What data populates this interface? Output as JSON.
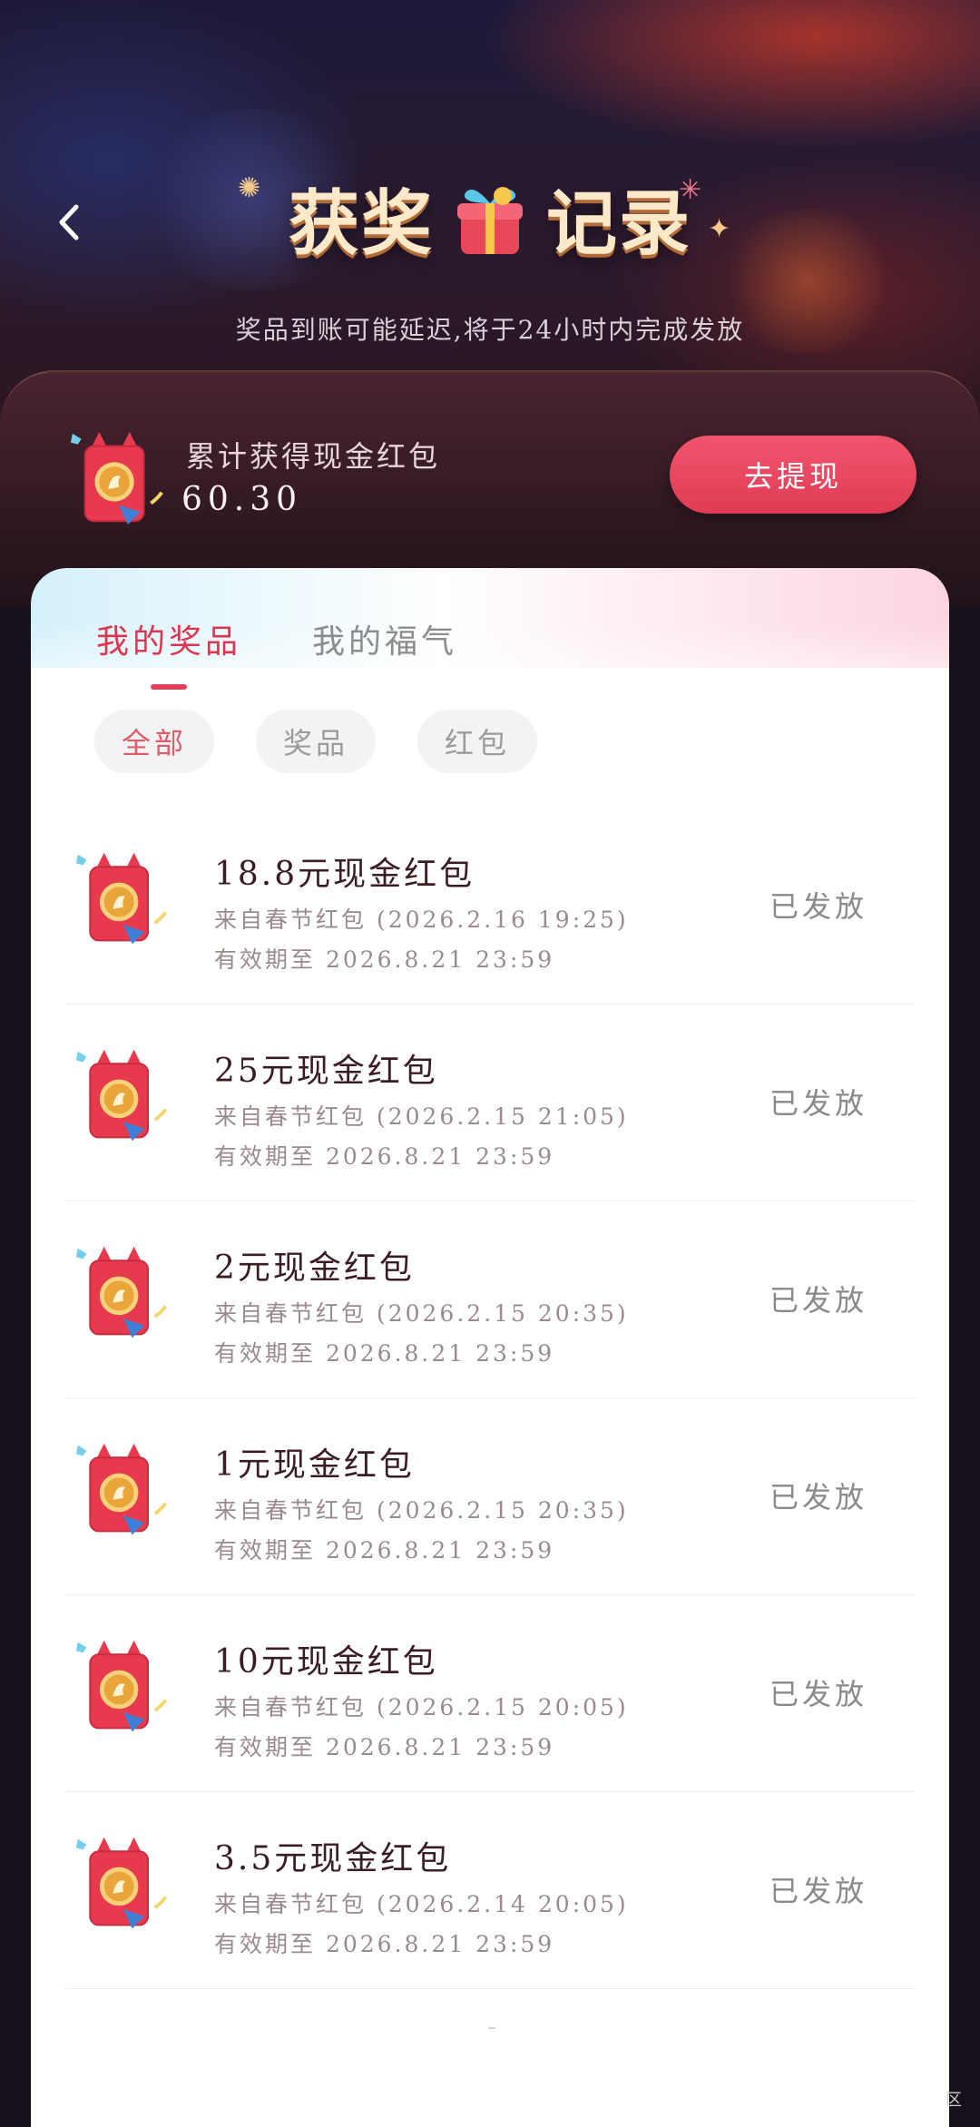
{
  "header": {
    "title_left": "获奖",
    "title_right": "记录",
    "subtitle": "奖品到账可能延迟,将于24小时内完成发放",
    "back_icon": "chevron-left-icon",
    "gift_icon": "gift-box-icon"
  },
  "summary": {
    "label": "累计获得现金红包",
    "amount": "60.30",
    "withdraw_label": "去提现",
    "icon": "red-packet-icon"
  },
  "tabs": [
    {
      "label": "我的奖品",
      "active": true
    },
    {
      "label": "我的福气",
      "active": false
    }
  ],
  "filters": [
    {
      "label": "全部",
      "active": true
    },
    {
      "label": "奖品",
      "active": false
    },
    {
      "label": "红包",
      "active": false
    }
  ],
  "records": [
    {
      "title": "18.8元现金红包",
      "source": "来自春节红包 (2026.2.16 19:25)",
      "expiry": "有效期至 2026.8.21 23:59",
      "status": "已发放"
    },
    {
      "title": "25元现金红包",
      "source": "来自春节红包 (2026.2.15 21:05)",
      "expiry": "有效期至 2026.8.21 23:59",
      "status": "已发放"
    },
    {
      "title": "2元现金红包",
      "source": "来自春节红包 (2026.2.15 20:35)",
      "expiry": "有效期至 2026.8.21 23:59",
      "status": "已发放"
    },
    {
      "title": "1元现金红包",
      "source": "来自春节红包 (2026.2.15 20:35)",
      "expiry": "有效期至 2026.8.21 23:59",
      "status": "已发放"
    },
    {
      "title": "10元现金红包",
      "source": "来自春节红包 (2026.2.15 20:05)",
      "expiry": "有效期至 2026.8.21 23:59",
      "status": "已发放"
    },
    {
      "title": "3.5元现金红包",
      "source": "来自春节红包 (2026.2.14 20:05)",
      "expiry": "有效期至 2026.8.21 23:59",
      "status": "已发放"
    }
  ],
  "footer": {
    "corner_text": "区"
  },
  "colors": {
    "accent": "#e03b55",
    "tab_active": "#d9364f",
    "status": "#8a8a8a"
  }
}
